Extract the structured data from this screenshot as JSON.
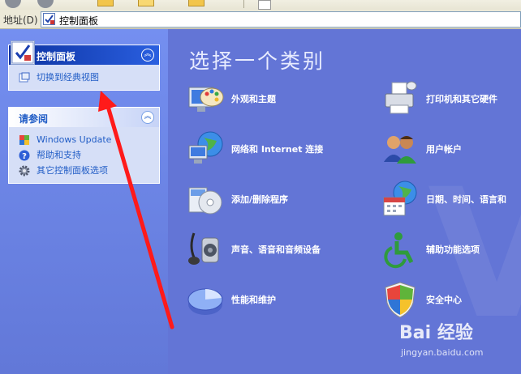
{
  "address_bar": {
    "label": "地址(D)",
    "path": "控制面板"
  },
  "left_pane": {
    "panel_control": {
      "title": "控制面板",
      "tasks": [
        {
          "label": "切换到经典视图",
          "icon": "switch-view-icon"
        }
      ]
    },
    "panel_see_also": {
      "title": "请参阅",
      "links": [
        {
          "label": "Windows Update",
          "icon": "windows-update-icon"
        },
        {
          "label": "帮助和支持",
          "icon": "help-icon"
        },
        {
          "label": "其它控制面板选项",
          "icon": "gear-icon"
        }
      ]
    }
  },
  "main": {
    "title": "选择一个类别",
    "categories": [
      {
        "label": "外观和主题",
        "icon": "appearance-palette-icon"
      },
      {
        "label": "打印机和其它硬件",
        "icon": "printer-icon"
      },
      {
        "label": "网络和 Internet 连接",
        "icon": "network-globe-icon"
      },
      {
        "label": "用户帐户",
        "icon": "user-accounts-icon"
      },
      {
        "label": "添加/删除程序",
        "icon": "add-remove-programs-icon"
      },
      {
        "label": "日期、时间、语言和",
        "icon": "date-time-globe-icon"
      },
      {
        "label": "声音、语音和音频设备",
        "icon": "sound-speaker-icon"
      },
      {
        "label": "辅助功能选项",
        "icon": "accessibility-icon"
      },
      {
        "label": "性能和维护",
        "icon": "performance-chart-icon"
      },
      {
        "label": "安全中心",
        "icon": "security-shield-icon"
      }
    ]
  },
  "watermark": {
    "brand": "Bai 经验",
    "url": "jingyan.baidu.com"
  },
  "colors": {
    "main_bg": "#6375d6",
    "panel_header": "#0c32a0",
    "link": "#215dc6",
    "arrow": "#ff1a1a"
  }
}
